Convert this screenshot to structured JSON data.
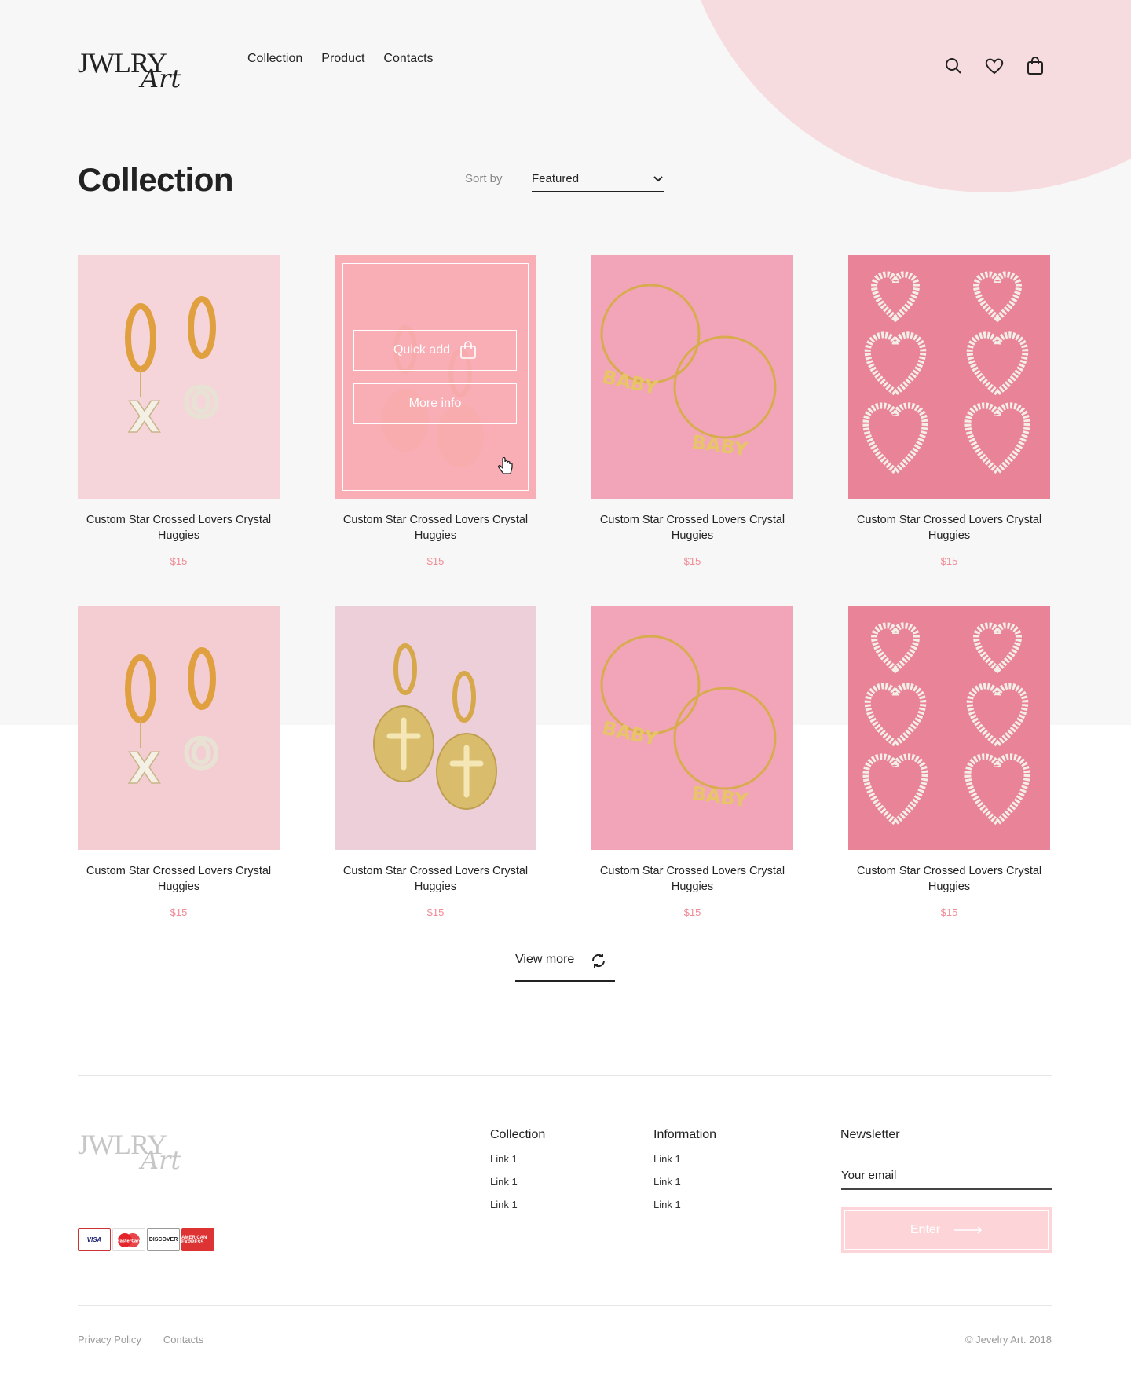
{
  "brand": {
    "logo_line1": "JWLRY",
    "logo_line2": "Art"
  },
  "nav": {
    "items": [
      "Collection",
      "Product",
      "Contacts"
    ]
  },
  "header_icons": [
    "search-icon",
    "heart-icon",
    "bag-icon"
  ],
  "page": {
    "title": "Collection",
    "sort_label": "Sort by",
    "sort_value": "Featured"
  },
  "colors": {
    "accent": "#f08b95",
    "blob": "#f7dcdf",
    "overlay": "#faaab2",
    "bg": "#f7f7f7",
    "button": "#fdd5d8"
  },
  "overlay": {
    "quick_add": "Quick add",
    "more_info": "More info"
  },
  "products": [
    {
      "name": "Custom Star Crossed Lovers Crystal Huggies",
      "price": "$15",
      "image": "xo-earrings"
    },
    {
      "name": "Custom Star Crossed Lovers Crystal Huggies",
      "price": "$15",
      "image": "cross-medallion-earrings"
    },
    {
      "name": "Custom Star Crossed Lovers Crystal Huggies",
      "price": "$15",
      "image": "baby-hoop-earrings"
    },
    {
      "name": "Custom Star Crossed Lovers Crystal Huggies",
      "price": "$15",
      "image": "heart-crystal-earrings"
    },
    {
      "name": "Custom Star Crossed Lovers Crystal Huggies",
      "price": "$15",
      "image": "xo-earrings"
    },
    {
      "name": "Custom Star Crossed Lovers Crystal Huggies",
      "price": "$15",
      "image": "cross-medallion-earrings"
    },
    {
      "name": "Custom Star Crossed Lovers Crystal Huggies",
      "price": "$15",
      "image": "baby-hoop-earrings"
    },
    {
      "name": "Custom Star Crossed Lovers Crystal Huggies",
      "price": "$15",
      "image": "heart-crystal-earrings"
    }
  ],
  "view_more": "View more",
  "footer": {
    "columns": [
      {
        "title": "Collection",
        "links": [
          "Link 1",
          "Link 1",
          "Link 1"
        ]
      },
      {
        "title": "Information",
        "links": [
          "Link 1",
          "Link 1",
          "Link 1"
        ]
      }
    ],
    "newsletter": {
      "title": "Newsletter",
      "placeholder": "Your email",
      "button": "Enter"
    },
    "payment": {
      "visa": "VISA",
      "mastercard": "MasterCard",
      "discover": "DISCOVER",
      "amex": "AMERICAN EXPRESS"
    },
    "bottom_links": [
      "Privacy Policy",
      "Contacts"
    ],
    "copyright": "© Jevelry Art. 2018"
  }
}
